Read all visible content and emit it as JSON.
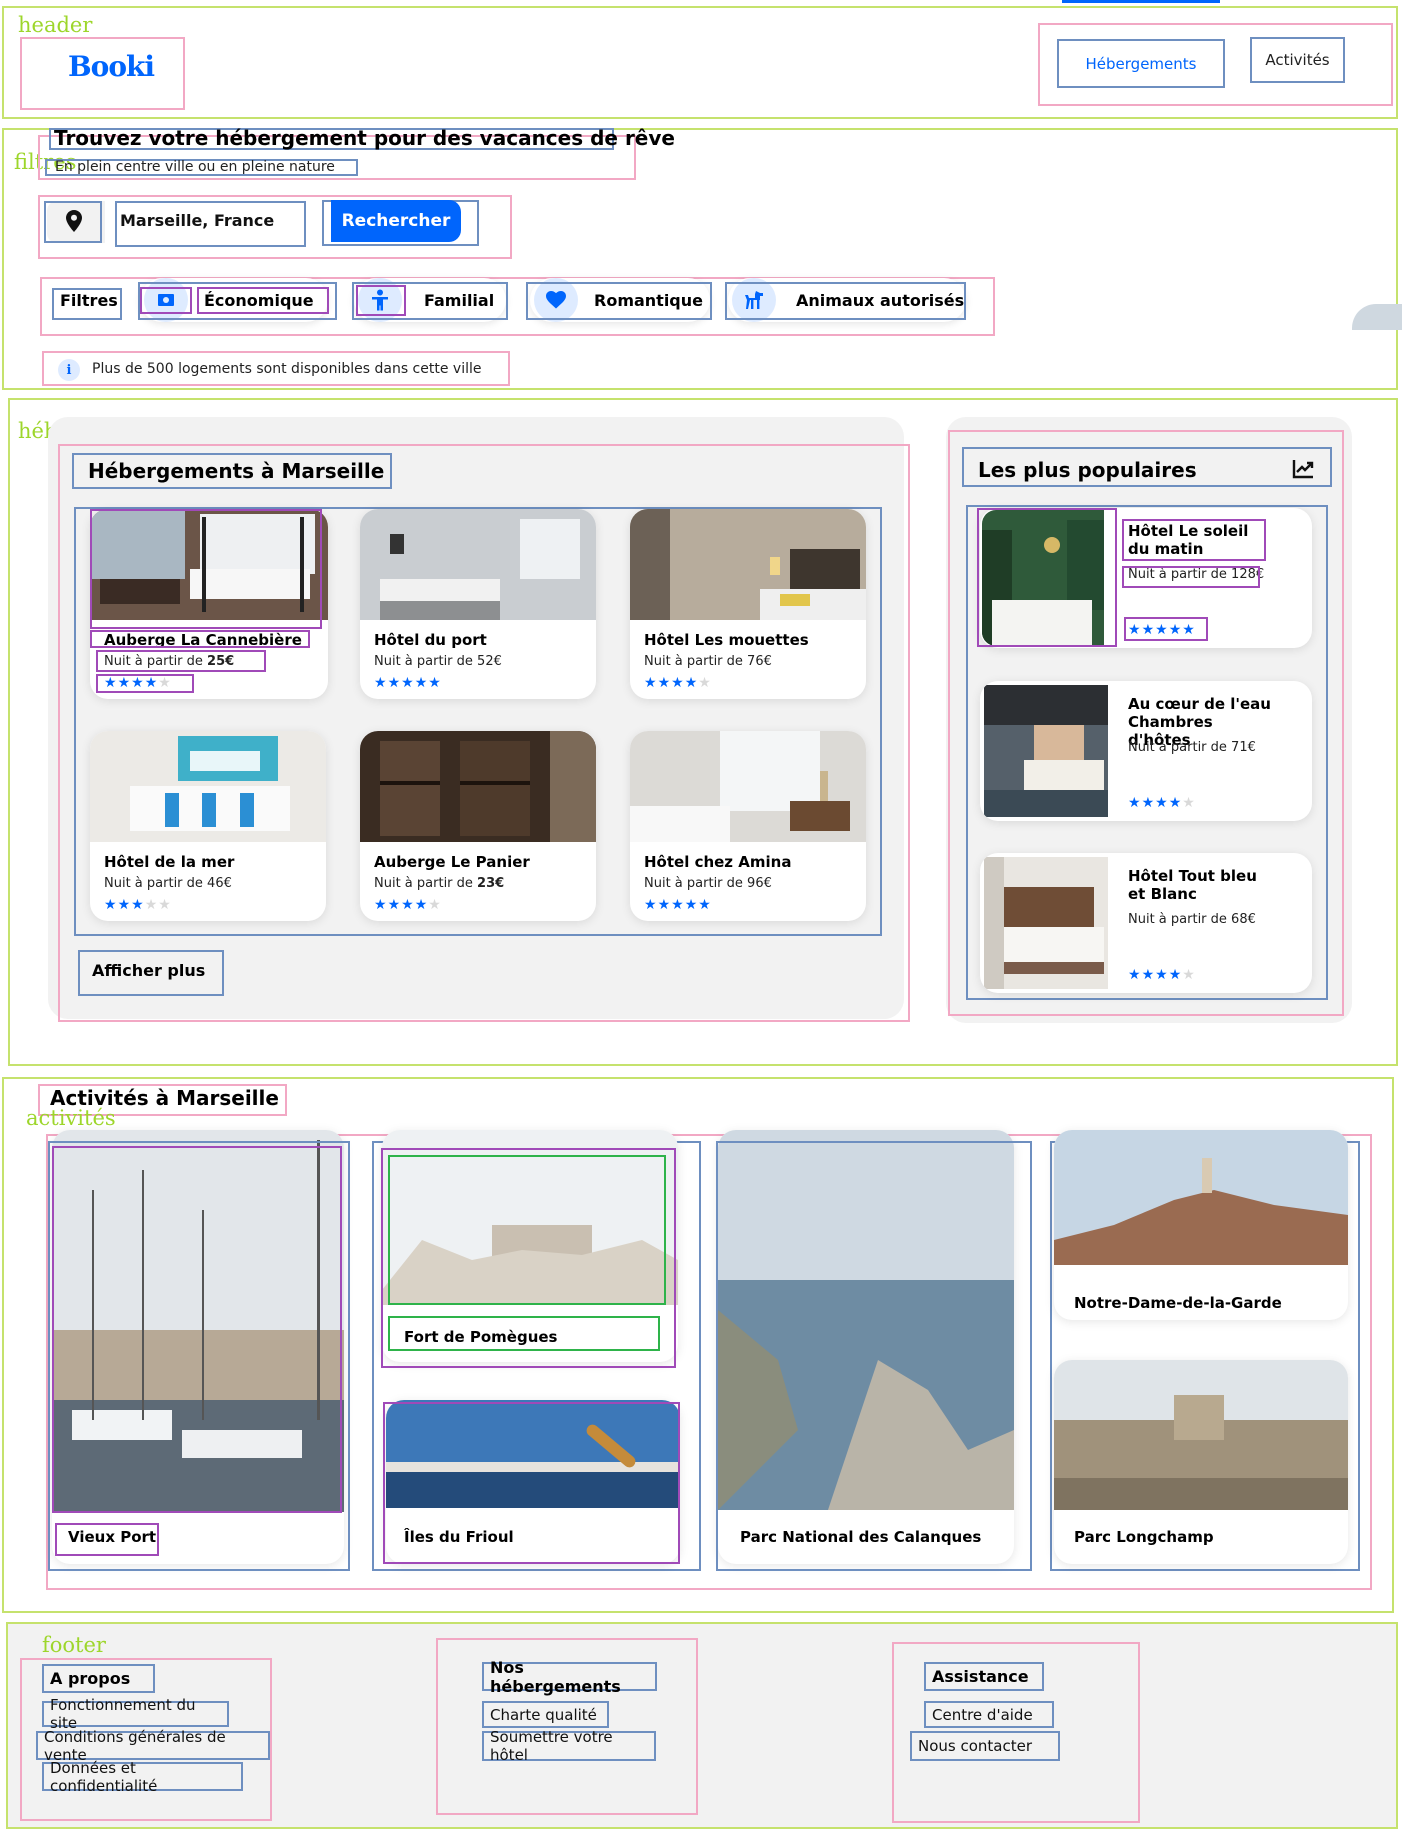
{
  "header": {
    "section_label": "header",
    "logo": "Booki",
    "nav": [
      "Hébergements",
      "Activités"
    ]
  },
  "filters": {
    "section_label": "filtres",
    "title": "Trouvez votre hébergement pour des vacances de rêve",
    "subtitle": "En plein centre ville ou en pleine nature",
    "search_value": "Marseille, France",
    "search_button": "Rechercher",
    "filters_label": "Filtres",
    "chips": [
      "Économique",
      "Familial",
      "Romantique",
      "Animaux autorisés"
    ],
    "info": "Plus de 500 logements sont disponibles dans cette ville"
  },
  "accommodations": {
    "section_label": "hébergements",
    "title": "Hébergements à Marseille",
    "price_prefix": "Nuit à partir de",
    "items": [
      {
        "name": "Auberge La Cannebière",
        "price": "25€",
        "rating": 4
      },
      {
        "name": "Hôtel du port",
        "price": "52€",
        "rating": 5
      },
      {
        "name": "Hôtel Les mouettes",
        "price": "76€",
        "rating": 4
      },
      {
        "name": "Hôtel de la mer",
        "price": "46€",
        "rating": 3
      },
      {
        "name": "Auberge Le Panier",
        "price": "23€",
        "rating": 4
      },
      {
        "name": "Hôtel chez Amina",
        "price": "96€",
        "rating": 5
      }
    ],
    "more_button": "Afficher plus"
  },
  "popular": {
    "title": "Les plus populaires",
    "price_prefix": "Nuit à partir de",
    "items": [
      {
        "name": "Hôtel Le soleil du matin",
        "price": "128€",
        "rating": 5
      },
      {
        "name": "Au cœur de l'eau Chambres d'hôtes",
        "price": "71€",
        "rating": 4
      },
      {
        "name": "Hôtel Tout bleu et Blanc",
        "price": "68€",
        "rating": 4
      }
    ]
  },
  "activities": {
    "section_label": "activités",
    "title": "Activités à Marseille",
    "items": [
      "Vieux Port",
      "Fort de Pomègues",
      "Îles du Frioul",
      "Parc National des Calanques",
      "Notre-Dame-de-la-Garde",
      "Parc Longchamp"
    ]
  },
  "footer": {
    "section_label": "footer",
    "columns": [
      {
        "heading": "A propos",
        "links": [
          "Fonctionnement du site",
          "Conditions générales de vente",
          "Données et confidentialité"
        ]
      },
      {
        "heading": "Nos hébergements",
        "links": [
          "Charte qualité",
          "Soumettre votre hôtel"
        ]
      },
      {
        "heading": "Assistance",
        "links": [
          "Centre d'aide",
          "Nous contacter"
        ]
      }
    ]
  },
  "colors": {
    "primary": "#0065fc",
    "primary_light": "#deebff",
    "panel": "#f2f2f2",
    "star_off": "#d9d9d9"
  },
  "icons": [
    "location-pin-icon",
    "money-icon",
    "child-icon",
    "heart-icon",
    "dog-icon",
    "info-icon",
    "trending-icon"
  ]
}
